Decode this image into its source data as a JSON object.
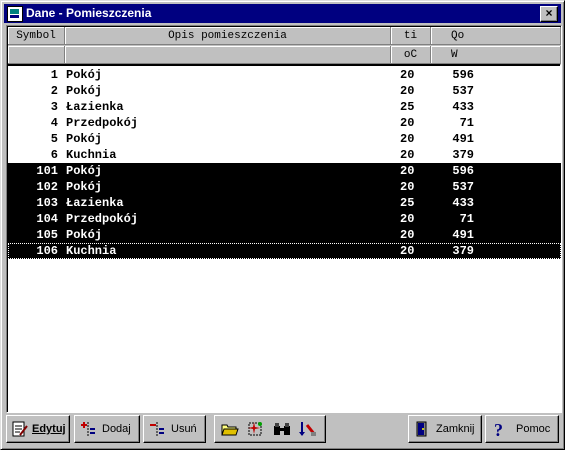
{
  "window": {
    "title": "Dane - Pomieszczenia",
    "close_glyph": "×"
  },
  "grid": {
    "headers": {
      "symbol": "Symbol",
      "opis": "Opis pomieszczenia",
      "ti": "ti",
      "ti_unit": "oC",
      "qo": "Qo",
      "qo_unit": "W"
    },
    "rows": [
      {
        "symbol": "1",
        "opis": "Pokój",
        "ti": "20",
        "qo": "596",
        "selected": false
      },
      {
        "symbol": "2",
        "opis": "Pokój",
        "ti": "20",
        "qo": "537",
        "selected": false
      },
      {
        "symbol": "3",
        "opis": "Łazienka",
        "ti": "25",
        "qo": "433",
        "selected": false
      },
      {
        "symbol": "4",
        "opis": "Przedpokój",
        "ti": "20",
        "qo": "71",
        "selected": false
      },
      {
        "symbol": "5",
        "opis": "Pokój",
        "ti": "20",
        "qo": "491",
        "selected": false
      },
      {
        "symbol": "6",
        "opis": "Kuchnia",
        "ti": "20",
        "qo": "379",
        "selected": false
      },
      {
        "symbol": "101",
        "opis": "Pokój",
        "ti": "20",
        "qo": "596",
        "selected": true
      },
      {
        "symbol": "102",
        "opis": "Pokój",
        "ti": "20",
        "qo": "537",
        "selected": true
      },
      {
        "symbol": "103",
        "opis": "Łazienka",
        "ti": "25",
        "qo": "433",
        "selected": true
      },
      {
        "symbol": "104",
        "opis": "Przedpokój",
        "ti": "20",
        "qo": "71",
        "selected": true
      },
      {
        "symbol": "105",
        "opis": "Pokój",
        "ti": "20",
        "qo": "491",
        "selected": true
      },
      {
        "symbol": "106",
        "opis": "Kuchnia",
        "ti": "20",
        "qo": "379",
        "selected": true
      }
    ]
  },
  "toolbar": {
    "edytuj": "Edytuj",
    "dodaj": "Dodaj",
    "usun": "Usuń",
    "zamknij": "Zamknij",
    "pomoc": "Pomoc",
    "icons": [
      "edit-icon",
      "add-icon",
      "delete-icon",
      "open-folder-icon",
      "select-icon",
      "find-binoculars-icon",
      "sort-icon",
      "close-door-icon",
      "help-icon"
    ]
  }
}
